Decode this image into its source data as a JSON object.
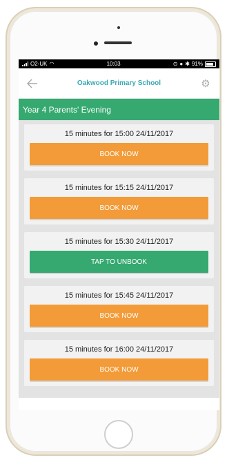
{
  "status_bar": {
    "carrier": "O2-UK",
    "time": "10:03",
    "battery": "91%"
  },
  "nav": {
    "title": "Oakwood Primary School",
    "back_icon": "back-arrow-icon",
    "settings_icon": "gear-icon"
  },
  "section": {
    "title": "Year 4 Parents' Evening"
  },
  "slots": [
    {
      "duration": "15 minutes",
      "mid": " for ",
      "when": "15:00 24/11/2017",
      "button": "BOOK NOW",
      "state": "available"
    },
    {
      "duration": "15 minutes",
      "mid": " for ",
      "when": "15:15 24/11/2017",
      "button": "BOOK NOW",
      "state": "available"
    },
    {
      "duration": "15 minutes",
      "mid": " for ",
      "when": "15:30 24/11/2017",
      "button": "TAP TO UNBOOK",
      "state": "booked"
    },
    {
      "duration": "15 minutes",
      "mid": " for ",
      "when": "15:45 24/11/2017",
      "button": "BOOK NOW",
      "state": "available"
    },
    {
      "duration": "15 minutes",
      "mid": " for ",
      "when": "16:00 24/11/2017",
      "button": "BOOK NOW",
      "state": "available"
    }
  ],
  "colors": {
    "accent_teal": "#3aa9b4",
    "book_orange": "#f29b38",
    "booked_green": "#35a96f"
  }
}
